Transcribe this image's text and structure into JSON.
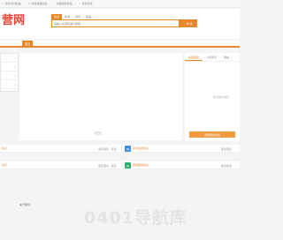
{
  "topbar": {
    "links": [
      {
        "icon": "phone-icon",
        "label": "手机访问此站"
      },
      {
        "icon": "bookmark-icon",
        "label": "快速收藏此站"
      },
      {
        "icon": "download-icon",
        "label": "桌面保存此站"
      },
      {
        "icon": "plus-icon",
        "label": "手机浏览"
      }
    ]
  },
  "logo": {
    "text": "营网"
  },
  "search": {
    "tabs": [
      "站点",
      "新闻",
      "资讯",
      "商品"
    ],
    "placeholder": "请输入关键词进行搜索",
    "button_label": "搜 索"
  },
  "nav": {
    "home": "首页"
  },
  "sidebar": {
    "items": [
      ">",
      ">",
      ">",
      ">"
    ]
  },
  "right_panel": {
    "tabs": [
      "最新更新",
      "公司资讯",
      "网站"
    ],
    "empty_text": "暂无相关信息",
    "button_label": "查看更多内容"
  },
  "sections": [
    {
      "title": "站点",
      "more": "更多更多 · 更多"
    },
    {
      "title": "资讯动态信息",
      "more": "更多更多"
    },
    {
      "title": "站点",
      "more": "更多更多 · 更多"
    },
    {
      "title": "网络服务信息",
      "more": "更多更多"
    }
  ],
  "footer": {
    "about": "关于我们",
    "watermark": "0401导航库"
  },
  "colors": {
    "accent": "#e8872a",
    "logo": "#ee4433",
    "icon_blue": "#3a8ee6",
    "icon_green": "#27b06b"
  }
}
